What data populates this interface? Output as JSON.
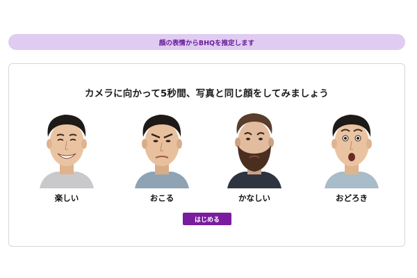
{
  "header": {
    "banner": "顔の表情からBHQを推定します"
  },
  "card": {
    "instruction": "カメラに向かって5秒間、写真と同じ顔をしてみましょう"
  },
  "expressions": [
    {
      "label": "楽しい"
    },
    {
      "label": "おこる"
    },
    {
      "label": "かなしい"
    },
    {
      "label": "おどろき"
    }
  ],
  "actions": {
    "start_label": "はじめる"
  },
  "colors": {
    "accent": "#7a1c9e",
    "banner_bg": "#e0ccf0",
    "banner_text": "#6a1e9c"
  }
}
